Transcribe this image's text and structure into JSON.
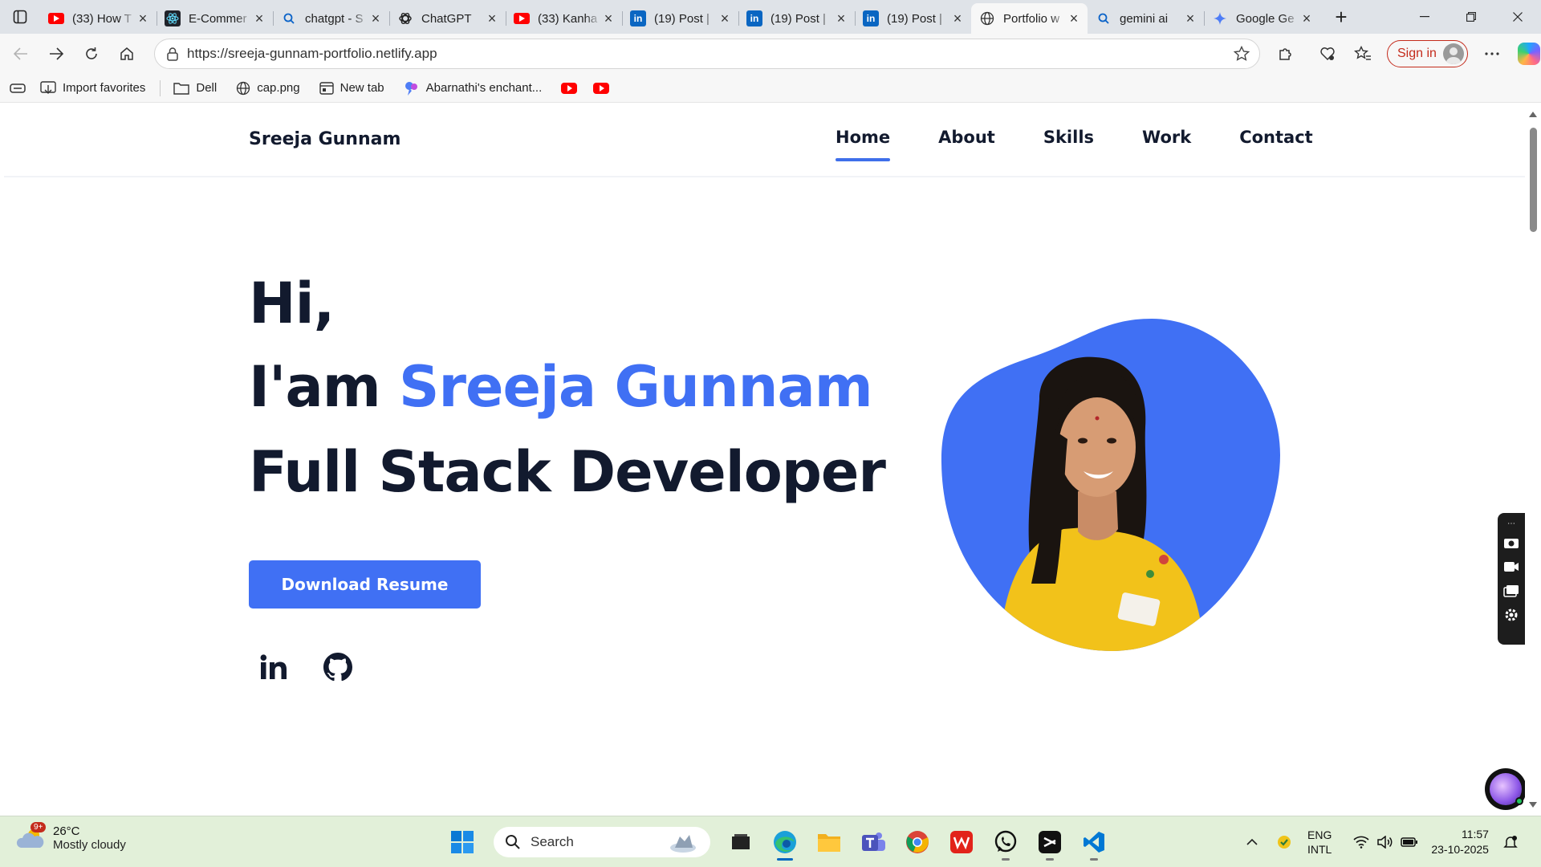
{
  "browser": {
    "tabs": [
      {
        "title": "(33) How T",
        "favicon": "youtube-icon",
        "active": false
      },
      {
        "title": "E-Commer",
        "favicon": "react-icon",
        "active": false
      },
      {
        "title": "chatgpt - S",
        "favicon": "search-icon",
        "active": false
      },
      {
        "title": "ChatGPT",
        "favicon": "chatgpt-icon",
        "active": false
      },
      {
        "title": "(33) Kanha",
        "favicon": "youtube-icon",
        "active": false
      },
      {
        "title": "(19) Post |",
        "favicon": "linkedin-icon",
        "active": false
      },
      {
        "title": "(19) Post |",
        "favicon": "linkedin-icon",
        "active": false
      },
      {
        "title": "(19) Post |",
        "favicon": "linkedin-icon",
        "active": false
      },
      {
        "title": "Portfolio w",
        "favicon": "globe-icon",
        "active": true
      },
      {
        "title": "gemini ai",
        "favicon": "search-icon",
        "active": false
      },
      {
        "title": "Google Ge",
        "favicon": "gemini-icon",
        "active": false
      }
    ],
    "url": "https://sreeja-gunnam-portfolio.netlify.app",
    "signin_label": "Sign in",
    "favorites": [
      {
        "label": "Import favorites",
        "icon": "import-icon"
      },
      {
        "label": "Dell",
        "icon": "folder-icon"
      },
      {
        "label": "cap.png",
        "icon": "globe-icon"
      },
      {
        "label": "New tab",
        "icon": "newtab-icon"
      },
      {
        "label": "Abarnathi's enchant...",
        "icon": "gemini-icon"
      }
    ]
  },
  "site": {
    "brand": "Sreeja Gunnam",
    "nav": [
      {
        "label": "Home",
        "active": true
      },
      {
        "label": "About",
        "active": false
      },
      {
        "label": "Skills",
        "active": false
      },
      {
        "label": "Work",
        "active": false
      },
      {
        "label": "Contact",
        "active": false
      }
    ],
    "hero": {
      "greeting": "Hi,",
      "intro": "I'am",
      "name": "Sreeja Gunnam",
      "role": "Full Stack Developer",
      "cta": "Download Resume"
    },
    "accent_color": "#4070f4",
    "text_color": "#121a2e"
  },
  "taskbar": {
    "weather_temp": "26°C",
    "weather_condition": "Mostly cloudy",
    "weather_badge": "9+",
    "search_placeholder": "Search",
    "lang_primary": "ENG",
    "lang_secondary": "INTL",
    "time": "11:57",
    "date": "23-10-2025"
  }
}
